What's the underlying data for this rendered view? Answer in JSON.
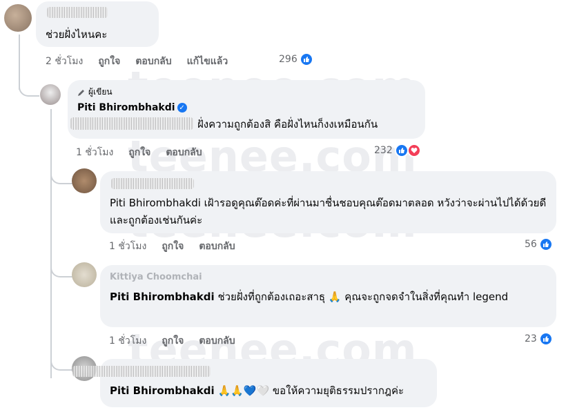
{
  "watermark": "teenee.com",
  "comments": [
    {
      "text": "ช่วยฝั่งไหนคะ",
      "time": "2 ชั่วโมง",
      "like": "ถูกใจ",
      "reply": "ตอบกลับ",
      "edited": "แก้ไขแล้ว",
      "reactions": "296"
    },
    {
      "role": "ผู้เขียน",
      "author": "Piti Bhirombhakdi",
      "text": "ฝั่งความถูกต้องสิ คือฝั่งไหนก็งงเหมือนกัน",
      "time": "1 ชั่วโมง",
      "like": "ถูกใจ",
      "reply": "ตอบกลับ",
      "reactions": "232"
    },
    {
      "mention": "Piti Bhirombhakdi",
      "text": "เฝ้ารอดูคุณต๊อดค่ะที่ผ่านมาชื่นชอบคุณต๊อดมาตลอด หวังว่าจะผ่านไปได้ด้วยดีและถูกต้องเช่นกันค่ะ",
      "time": "1 ชั่วโมง",
      "like": "ถูกใจ",
      "reply": "ตอบกลับ",
      "reactions": "56"
    },
    {
      "author": "Kittiya Choomchai",
      "mention": "Piti Bhirombhakdi",
      "text": "ช่วยฝั่งที่ถูกต้องเถอะสาธุ 🙏 คุณจะถูกจดจำในสิ่งที่คุณทำ legend",
      "time": "1 ชั่วโมง",
      "like": "ถูกใจ",
      "reply": "ตอบกลับ",
      "reactions": "23"
    },
    {
      "mention": "Piti Bhirombhakdi",
      "text": "🙏🙏💙🤍 ขอให้ความยุติธรรมปรากฎค่ะ"
    }
  ],
  "colors": {
    "like": "#1877f2",
    "love": "#f33e58",
    "bubble": "#f0f2f5",
    "meta": "#65676b"
  }
}
